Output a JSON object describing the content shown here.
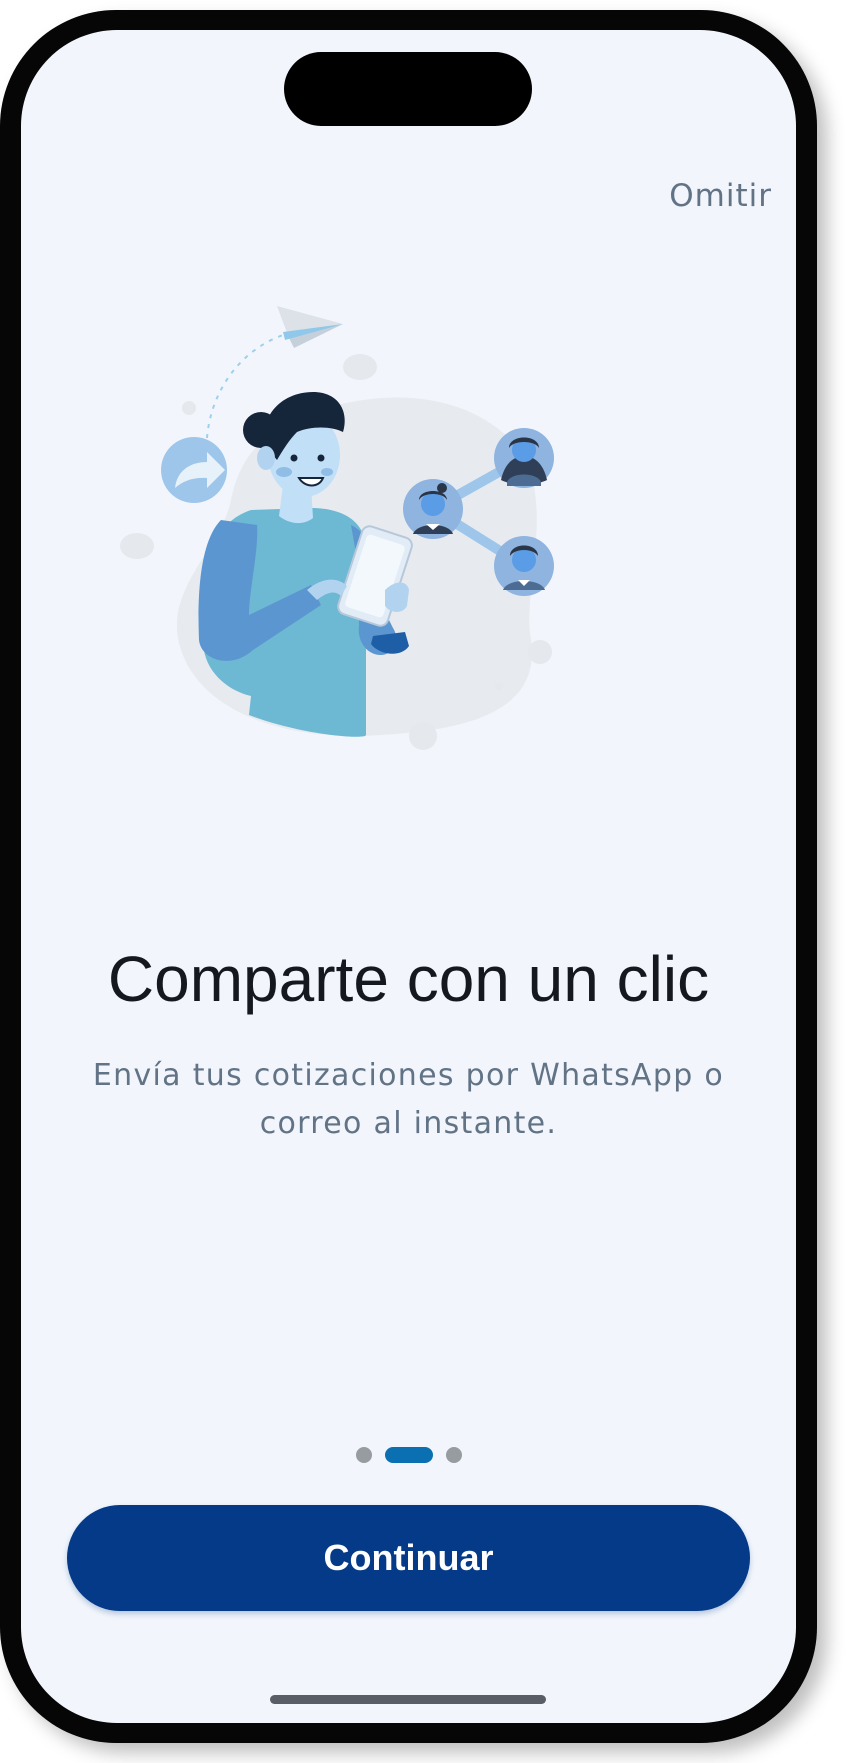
{
  "onboarding": {
    "skip_label": "Omitir",
    "title": "Comparte con un clic",
    "subtitle": "Envía tus cotizaciones por WhatsApp o correo al instante.",
    "pagination": {
      "total": 3,
      "active_index": 1
    },
    "continue_label": "Continuar",
    "illustration_icons": [
      "paper-plane-icon",
      "share-icon",
      "contact-network-icon",
      "tablet-icon"
    ]
  },
  "colors": {
    "background": "#f2f6fc",
    "primary_button": "#043a87",
    "active_dot": "#0b70b2",
    "inactive_dot": "#979ca1",
    "title_text": "#15181f",
    "secondary_text": "#627386"
  }
}
